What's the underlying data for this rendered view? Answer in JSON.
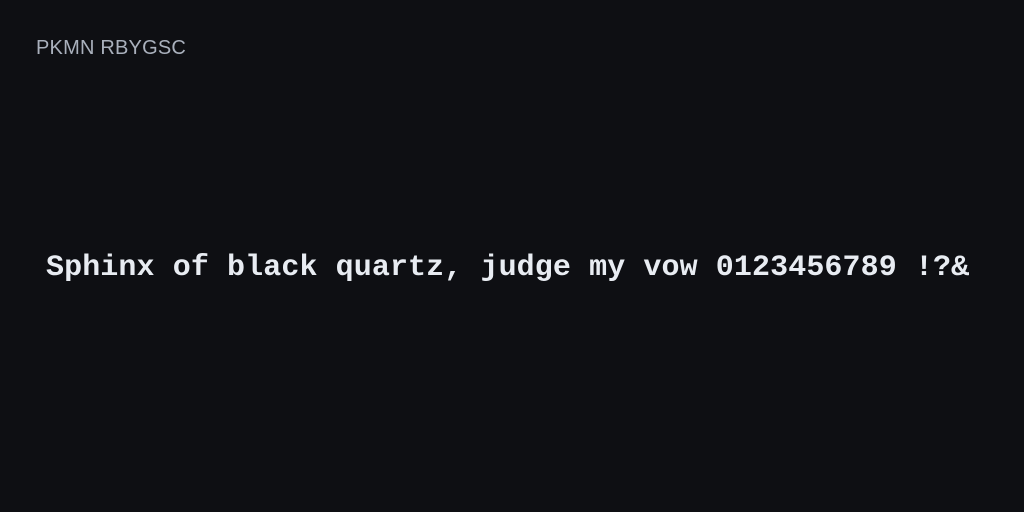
{
  "font_name": "PKMN RBYGSC",
  "specimen_text": "Sphinx of black quartz, judge my vow 0123456789 !?&"
}
